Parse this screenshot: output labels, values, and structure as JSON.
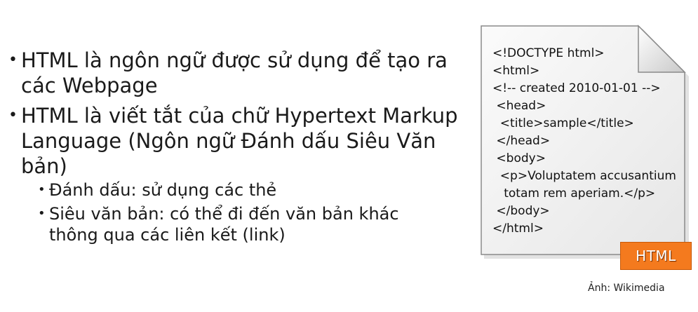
{
  "bullets": {
    "b1": "HTML là ngôn ngữ được sử dụng để tạo ra các Webpage",
    "b2": "HTML là viết tắt của chữ Hypertext Markup Language (Ngôn ngữ Đánh dấu Siêu Văn bản)",
    "b3": "Đánh dấu: sử dụng các thẻ",
    "b4": "Siêu văn bản: có thể đi đến văn bản khác thông qua các liên kết (link)"
  },
  "bullet_symbol": "•",
  "code_sample": {
    "lines": [
      "<!DOCTYPE html>",
      "<html>",
      "<!-- created 2010-01-01 -->",
      " <head>",
      "  <title>sample</title>",
      " </head>",
      " <body>",
      "  <p>Voluptatem accusantium",
      "   totam rem aperiam.</p>",
      " </body>",
      "</html>"
    ]
  },
  "badge": {
    "label": "HTML",
    "color": "#f47a1e"
  },
  "caption": "Ảnh: Wikimedia"
}
